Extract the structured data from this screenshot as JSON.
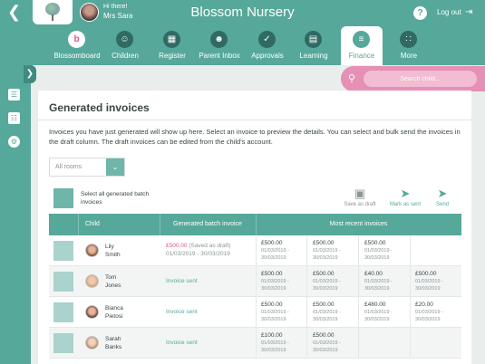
{
  "app": {
    "title": "Blossom Nursery",
    "greeting": "Hi there!",
    "user_name": "Mrs Sara",
    "logout_label": "Log out",
    "help_symbol": "?"
  },
  "nav": {
    "items": [
      {
        "label": "Blossomboard",
        "icon": "b-logo-icon"
      },
      {
        "label": "Children",
        "icon": "smiley-icon"
      },
      {
        "label": "Register",
        "icon": "calendar-icon"
      },
      {
        "label": "Parent Inbox",
        "icon": "parent-icon"
      },
      {
        "label": "Approvals",
        "icon": "clipboard-icon"
      },
      {
        "label": "Learning",
        "icon": "book-icon"
      },
      {
        "label": "Finance",
        "icon": "chart-icon",
        "active": true
      },
      {
        "label": "More",
        "icon": "grid-icon"
      }
    ]
  },
  "search": {
    "placeholder": "Search child..."
  },
  "invoices": {
    "title": "Generated invoices",
    "description": "Invoices you have just generated will show up here. Select an invoice to preview the details. You can select and bulk send the invoices in the draft column. The draft invoices can be edited from the child's account.",
    "room_filter": "All rooms",
    "select_all_label": "Select all generated batch invoices",
    "actions": {
      "save_draft": "Save as draft",
      "mark_sent": "Mark as sent",
      "send": "Send"
    },
    "columns": {
      "child": "Child",
      "batch": "Generated batch invoice",
      "recent": "Most recent invoices"
    },
    "rows": [
      {
        "first": "Lily",
        "last": "Smith",
        "batch_amount": "£500.00",
        "batch_note": "(Saved as draft)",
        "batch_dates": "01/03/2019 - 30/03/2019",
        "recent": [
          {
            "amount": "£500.00",
            "from": "01/03/2019 -",
            "to": "30/03/2019"
          },
          {
            "amount": "£500.00",
            "from": "01/03/2019 -",
            "to": "30/03/2019"
          },
          {
            "amount": "£500.00",
            "from": "01/03/2019 -",
            "to": "30/03/2019"
          }
        ]
      },
      {
        "first": "Tom",
        "last": "Jones",
        "batch_sent": "Invoice sent",
        "recent": [
          {
            "amount": "£500.00",
            "from": "01/03/2019 -",
            "to": "30/03/2019"
          },
          {
            "amount": "£500.00",
            "from": "01/03/2019 -",
            "to": "30/03/2019"
          },
          {
            "amount": "£40.00",
            "from": "01/03/2019 -",
            "to": "30/03/2019"
          },
          {
            "amount": "£500.00",
            "from": "01/03/2019 -",
            "to": "30/03/2019"
          }
        ]
      },
      {
        "first": "Bianca",
        "last": "Pietosi",
        "batch_sent": "Invoice sent",
        "recent": [
          {
            "amount": "£500.00",
            "from": "01/03/2019 -",
            "to": "30/03/2019"
          },
          {
            "amount": "£500.00",
            "from": "01/03/2019 -",
            "to": "30/03/2019"
          },
          {
            "amount": "£480.00",
            "from": "01/03/2019 -",
            "to": "30/03/2019"
          },
          {
            "amount": "£20.00",
            "from": "01/03/2019 -",
            "to": "30/03/2019"
          }
        ]
      },
      {
        "first": "Sarah",
        "last": "Banks",
        "batch_sent": "Invoice sent",
        "recent": [
          {
            "amount": "£100.00",
            "from": "01/03/2019 -",
            "to": "30/03/2019"
          },
          {
            "amount": "£500.00",
            "from": "01/03/2019 -",
            "to": "30/03/2019"
          }
        ]
      }
    ]
  },
  "colors": {
    "primary": "#56a89a",
    "pink": "#e590b4",
    "accent_pink": "#d9548a"
  }
}
